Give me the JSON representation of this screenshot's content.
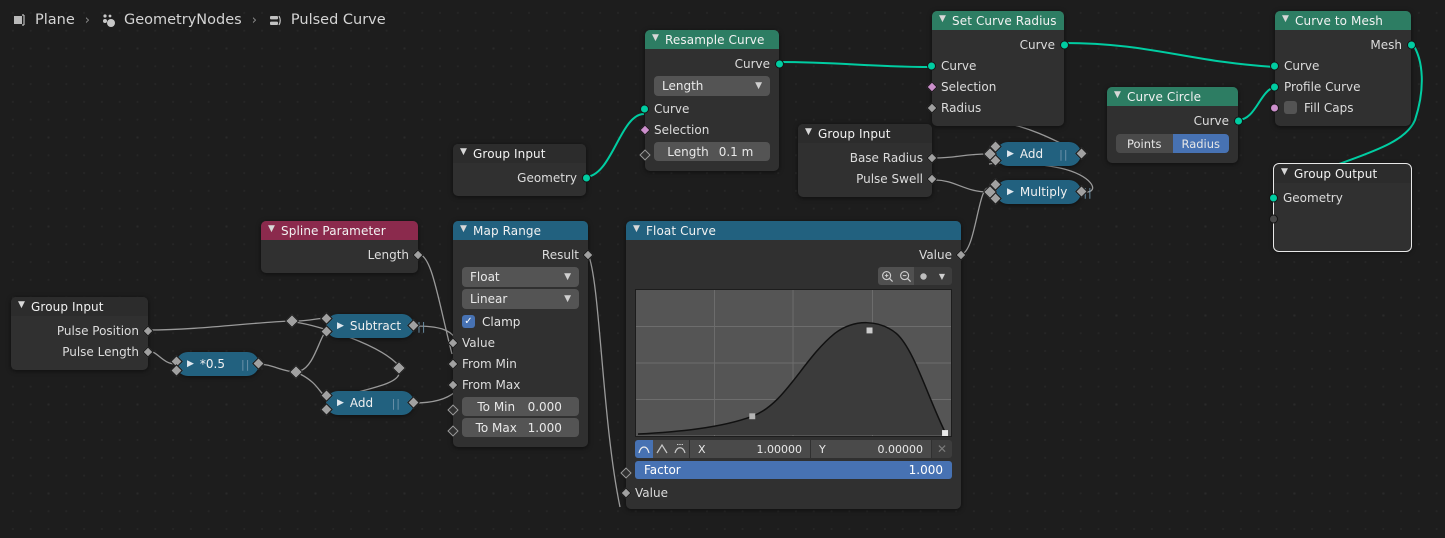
{
  "breadcrumb": {
    "items": [
      {
        "icon": "object-plane-icon",
        "label": "Plane"
      },
      {
        "icon": "geometry-nodes-icon",
        "label": "GeometryNodes"
      },
      {
        "icon": "node-group-icon",
        "label": "Pulsed Curve"
      }
    ],
    "separator": "›"
  },
  "colors": {
    "geometry_header": "#2d7d63",
    "converter_header": "#22617f",
    "input_header": "#8b2a4d",
    "accent_blue": "#4772b3",
    "socket_geometry": "#00cda2",
    "socket_boolean": "#cc8fcc",
    "socket_float": "#a1a1a1",
    "node_body": "#303030",
    "editor_bg": "#1d1d1d"
  },
  "nodes": {
    "group_input_geometry": {
      "title": "Group Input",
      "outputs": [
        "Geometry"
      ]
    },
    "resample_curve": {
      "title": "Resample Curve",
      "outputs": [
        "Curve"
      ],
      "mode_dropdown": "Length",
      "inputs": [
        "Curve",
        "Selection"
      ],
      "length_field": {
        "label": "Length",
        "value": "0.1 m"
      }
    },
    "set_curve_radius": {
      "title": "Set Curve Radius",
      "outputs": [
        "Curve"
      ],
      "inputs": [
        "Curve",
        "Selection",
        "Radius"
      ]
    },
    "curve_circle": {
      "title": "Curve Circle",
      "outputs": [
        "Curve"
      ],
      "toggle": {
        "options": [
          "Points",
          "Radius"
        ],
        "selected": "Radius"
      }
    },
    "curve_to_mesh": {
      "title": "Curve to Mesh",
      "outputs": [
        "Mesh"
      ],
      "inputs": [
        "Curve",
        "Profile Curve"
      ],
      "fill_caps": {
        "label": "Fill Caps",
        "checked": false
      }
    },
    "group_output": {
      "title": "Group Output",
      "inputs": [
        "Geometry"
      ],
      "selected": true
    },
    "group_input_radius": {
      "title": "Group Input",
      "outputs": [
        "Base Radius",
        "Pulse Swell"
      ]
    },
    "group_input_pulse": {
      "title": "Group Input",
      "outputs": [
        "Pulse Position",
        "Pulse Length"
      ]
    },
    "spline_parameter": {
      "title": "Spline Parameter",
      "outputs": [
        "Length"
      ]
    },
    "map_range": {
      "title": "Map Range",
      "outputs": [
        "Result"
      ],
      "data_type": "Float",
      "interpolation": "Linear",
      "clamp": {
        "label": "Clamp",
        "checked": true
      },
      "inputs": [
        "Value",
        "From Min",
        "From Max"
      ],
      "to_min": {
        "label": "To Min",
        "value": "0.000"
      },
      "to_max": {
        "label": "To Max",
        "value": "1.000"
      }
    },
    "float_curve": {
      "title": "Float Curve",
      "outputs": [
        "Value"
      ],
      "tools": [
        "zoom-in-icon",
        "zoom-out-icon",
        "clipping-icon",
        "chevron-down-icon"
      ],
      "handle_types": [
        "auto-handle-icon",
        "vector-handle-icon",
        "auto-clamped-handle-icon"
      ],
      "handle_selected": "auto-handle-icon",
      "coord_x": {
        "label": "X",
        "value": "1.00000"
      },
      "coord_y": {
        "label": "Y",
        "value": "0.00000"
      },
      "delete_icon": "close-icon",
      "factor": {
        "label": "Factor",
        "value": "1.000"
      },
      "inputs": [
        "Value"
      ]
    },
    "math_half": {
      "label": "*0.5",
      "type": "collapsed-math"
    },
    "math_subtract": {
      "label": "Subtract",
      "type": "collapsed-math"
    },
    "math_add_lower": {
      "label": "Add",
      "type": "collapsed-math"
    },
    "math_add_radius": {
      "label": "Add",
      "type": "collapsed-math"
    },
    "math_multiply": {
      "label": "Multiply",
      "type": "collapsed-math"
    }
  },
  "chart_data": {
    "type": "line",
    "title": "Float Curve",
    "xlabel": "",
    "ylabel": "",
    "xlim": [
      0,
      1
    ],
    "ylim": [
      0,
      1
    ],
    "grid": true,
    "grid_divisions": 4,
    "control_points": [
      {
        "x": 0.0,
        "y": 0.0
      },
      {
        "x": 0.37,
        "y": 0.07
      },
      {
        "x": 0.73,
        "y": 0.82
      },
      {
        "x": 1.0,
        "y": 0.0
      }
    ],
    "selected_point": {
      "x": 1.0,
      "y": 0.0
    }
  }
}
